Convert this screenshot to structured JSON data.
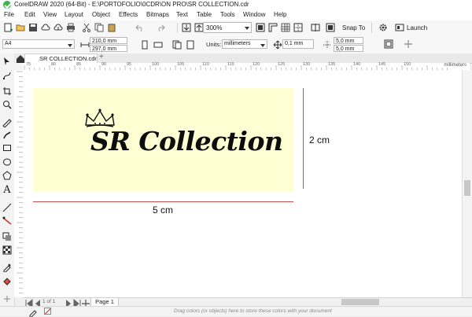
{
  "window": {
    "title": "CorelDRAW 2020 (64-Bit) - E:\\PORTOFOLIO\\0CDR\\ON PRO\\SR COLLECTION.cdr"
  },
  "menu": [
    "File",
    "Edit",
    "View",
    "Layout",
    "Object",
    "Effects",
    "Bitmaps",
    "Text",
    "Table",
    "Tools",
    "Window",
    "Help"
  ],
  "toolbar": {
    "zoom": "300%",
    "snap_label": "Snap To",
    "launch_label": "Launch",
    "icons": [
      "new-document-icon",
      "open-icon",
      "save-icon",
      "import-icon",
      "export-icon",
      "print-icon",
      "cut-icon",
      "copy-icon",
      "paste-icon",
      "undo-icon",
      "redo-icon",
      "search-content-icon",
      "import-button-icon",
      "pdf-icon",
      "full-screen-icon",
      "show-rulers-icon",
      "show-grid-icon",
      "options-icon"
    ]
  },
  "property_bar": {
    "page_size": "A4",
    "width": "210,0 mm",
    "height": "297,0 mm",
    "units_label": "Units:",
    "units_value": "millimeters",
    "nudge": "0,1 mm",
    "dup_x": "5,0 mm",
    "dup_y": "5,0 mm"
  },
  "document": {
    "tab_label": "SR COLLECTION.cdr",
    "ruler_unit": "millimeters",
    "ruler_ticks": [
      "75",
      "80",
      "85",
      "90",
      "95",
      "100",
      "105",
      "110",
      "115",
      "120",
      "125",
      "130",
      "135",
      "140",
      "145",
      "150"
    ],
    "page_label": "Page 1",
    "page_count": "1 of 1"
  },
  "design": {
    "brand_text": "SR Collection",
    "height_label": "2 cm",
    "width_label": "5 cm",
    "background_color": "#ffffd4",
    "dimension_line_color": "#c05050"
  },
  "status": {
    "hint": "Drag colors (or objects) here to store these colors with your document"
  }
}
